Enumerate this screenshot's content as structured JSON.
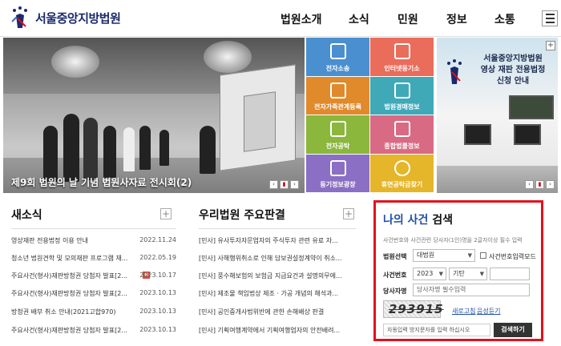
{
  "header": {
    "logo_text": "서울중앙지방법원",
    "nav": [
      "법원소개",
      "소식",
      "민원",
      "정보",
      "소통"
    ]
  },
  "hero": {
    "caption": "제9회 법원의 날 기념 법원사자료 전시회(2)"
  },
  "tiles": [
    {
      "label": "전자소송",
      "color": "#4a8fd0"
    },
    {
      "label": "인터넷등기소",
      "color": "#ea6c5a"
    },
    {
      "label": "전자가족관계등록",
      "color": "#e08a2c"
    },
    {
      "label": "법원경매정보",
      "color": "#3fa9b8"
    },
    {
      "label": "전자공탁",
      "color": "#8ab73c"
    },
    {
      "label": "종합법률정보",
      "color": "#d96a84"
    },
    {
      "label": "등기정보광장",
      "color": "#8a6fc4"
    },
    {
      "label": "휴면공탁금찾기",
      "color": "#e5b52a"
    }
  ],
  "promo": {
    "line1": "서울중앙지방법원",
    "line2": "영상 재판 전용법정",
    "line3": "신청 안내"
  },
  "news": {
    "title": "새소식",
    "items": [
      {
        "text": "영상재판 전용법정 이용 안내",
        "date": "2022.11.24",
        "new": false
      },
      {
        "text": "청소년 법원견학 및 모의재판 프로그램 재...",
        "date": "2022.05.19",
        "new": false
      },
      {
        "text": "주요사건(형사)재판방청권 당첨자 발표[2...",
        "date": "2023.10.17",
        "new": true
      },
      {
        "text": "주요사건(형사)재판방청권 당첨자 발표[2...",
        "date": "2023.10.13",
        "new": false
      },
      {
        "text": "방청권 배부 취소 안내(2021고합970)",
        "date": "2023.10.13",
        "new": false
      },
      {
        "text": "주요사건(형사)재판방청권 당첨자 발표[2...",
        "date": "2023.10.13",
        "new": false
      }
    ],
    "new_badge": "N"
  },
  "cases": {
    "title": "우리법원 주요판결",
    "items": [
      "[민사] 유사투자자문업자의 주식투자 관련 유료 자...",
      "[민사] 사해행위취소로 인해 담보권설정계약이 취소...",
      "[민사] 풍수해보험의 보험금 지급요건과 설명의무에...",
      "[민사] 제조물 책임법상 제조 · 가공 개념의 해석과...",
      "[민사] 공인중개사법위반에 관한 손해배상 판결",
      "[민사] 기획여행계약에서 기획여행업자의 안전배려..."
    ]
  },
  "case_search": {
    "title_highlight": "나의 사건",
    "title_rest": " 검색",
    "note": "사건번호와 사건관련 당사자(1인)명을 2글자이상 필수 입력",
    "court_label": "법원선택",
    "court_value": "대법원",
    "number_mode_label": "사건번호입력모드",
    "case_number_label": "사건번호",
    "year_value": "2023",
    "type_value": "기탄",
    "party_label": "당사자명",
    "party_placeholder": "당사자명 필수입력",
    "captcha_text": "293915",
    "refresh_link": "새로고침",
    "audio_link": "음성듣기",
    "captcha_placeholder": "자동입력 방지문자를 입력 하십시오",
    "search_button": "검색하기"
  }
}
